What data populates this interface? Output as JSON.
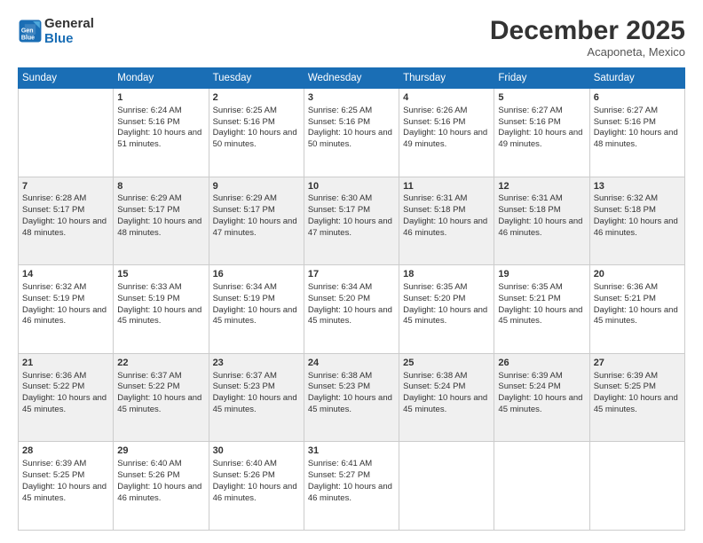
{
  "header": {
    "logo_line1": "General",
    "logo_line2": "Blue",
    "month_title": "December 2025",
    "location": "Acaponeta, Mexico"
  },
  "days_of_week": [
    "Sunday",
    "Monday",
    "Tuesday",
    "Wednesday",
    "Thursday",
    "Friday",
    "Saturday"
  ],
  "weeks": [
    {
      "row_class": "week-odd",
      "days": [
        {
          "num": "",
          "empty": true
        },
        {
          "num": "1",
          "sunrise": "Sunrise: 6:24 AM",
          "sunset": "Sunset: 5:16 PM",
          "daylight": "Daylight: 10 hours and 51 minutes."
        },
        {
          "num": "2",
          "sunrise": "Sunrise: 6:25 AM",
          "sunset": "Sunset: 5:16 PM",
          "daylight": "Daylight: 10 hours and 50 minutes."
        },
        {
          "num": "3",
          "sunrise": "Sunrise: 6:25 AM",
          "sunset": "Sunset: 5:16 PM",
          "daylight": "Daylight: 10 hours and 50 minutes."
        },
        {
          "num": "4",
          "sunrise": "Sunrise: 6:26 AM",
          "sunset": "Sunset: 5:16 PM",
          "daylight": "Daylight: 10 hours and 49 minutes."
        },
        {
          "num": "5",
          "sunrise": "Sunrise: 6:27 AM",
          "sunset": "Sunset: 5:16 PM",
          "daylight": "Daylight: 10 hours and 49 minutes."
        },
        {
          "num": "6",
          "sunrise": "Sunrise: 6:27 AM",
          "sunset": "Sunset: 5:16 PM",
          "daylight": "Daylight: 10 hours and 48 minutes."
        }
      ]
    },
    {
      "row_class": "week-even",
      "days": [
        {
          "num": "7",
          "sunrise": "Sunrise: 6:28 AM",
          "sunset": "Sunset: 5:17 PM",
          "daylight": "Daylight: 10 hours and 48 minutes."
        },
        {
          "num": "8",
          "sunrise": "Sunrise: 6:29 AM",
          "sunset": "Sunset: 5:17 PM",
          "daylight": "Daylight: 10 hours and 48 minutes."
        },
        {
          "num": "9",
          "sunrise": "Sunrise: 6:29 AM",
          "sunset": "Sunset: 5:17 PM",
          "daylight": "Daylight: 10 hours and 47 minutes."
        },
        {
          "num": "10",
          "sunrise": "Sunrise: 6:30 AM",
          "sunset": "Sunset: 5:17 PM",
          "daylight": "Daylight: 10 hours and 47 minutes."
        },
        {
          "num": "11",
          "sunrise": "Sunrise: 6:31 AM",
          "sunset": "Sunset: 5:18 PM",
          "daylight": "Daylight: 10 hours and 46 minutes."
        },
        {
          "num": "12",
          "sunrise": "Sunrise: 6:31 AM",
          "sunset": "Sunset: 5:18 PM",
          "daylight": "Daylight: 10 hours and 46 minutes."
        },
        {
          "num": "13",
          "sunrise": "Sunrise: 6:32 AM",
          "sunset": "Sunset: 5:18 PM",
          "daylight": "Daylight: 10 hours and 46 minutes."
        }
      ]
    },
    {
      "row_class": "week-odd",
      "days": [
        {
          "num": "14",
          "sunrise": "Sunrise: 6:32 AM",
          "sunset": "Sunset: 5:19 PM",
          "daylight": "Daylight: 10 hours and 46 minutes."
        },
        {
          "num": "15",
          "sunrise": "Sunrise: 6:33 AM",
          "sunset": "Sunset: 5:19 PM",
          "daylight": "Daylight: 10 hours and 45 minutes."
        },
        {
          "num": "16",
          "sunrise": "Sunrise: 6:34 AM",
          "sunset": "Sunset: 5:19 PM",
          "daylight": "Daylight: 10 hours and 45 minutes."
        },
        {
          "num": "17",
          "sunrise": "Sunrise: 6:34 AM",
          "sunset": "Sunset: 5:20 PM",
          "daylight": "Daylight: 10 hours and 45 minutes."
        },
        {
          "num": "18",
          "sunrise": "Sunrise: 6:35 AM",
          "sunset": "Sunset: 5:20 PM",
          "daylight": "Daylight: 10 hours and 45 minutes."
        },
        {
          "num": "19",
          "sunrise": "Sunrise: 6:35 AM",
          "sunset": "Sunset: 5:21 PM",
          "daylight": "Daylight: 10 hours and 45 minutes."
        },
        {
          "num": "20",
          "sunrise": "Sunrise: 6:36 AM",
          "sunset": "Sunset: 5:21 PM",
          "daylight": "Daylight: 10 hours and 45 minutes."
        }
      ]
    },
    {
      "row_class": "week-even",
      "days": [
        {
          "num": "21",
          "sunrise": "Sunrise: 6:36 AM",
          "sunset": "Sunset: 5:22 PM",
          "daylight": "Daylight: 10 hours and 45 minutes."
        },
        {
          "num": "22",
          "sunrise": "Sunrise: 6:37 AM",
          "sunset": "Sunset: 5:22 PM",
          "daylight": "Daylight: 10 hours and 45 minutes."
        },
        {
          "num": "23",
          "sunrise": "Sunrise: 6:37 AM",
          "sunset": "Sunset: 5:23 PM",
          "daylight": "Daylight: 10 hours and 45 minutes."
        },
        {
          "num": "24",
          "sunrise": "Sunrise: 6:38 AM",
          "sunset": "Sunset: 5:23 PM",
          "daylight": "Daylight: 10 hours and 45 minutes."
        },
        {
          "num": "25",
          "sunrise": "Sunrise: 6:38 AM",
          "sunset": "Sunset: 5:24 PM",
          "daylight": "Daylight: 10 hours and 45 minutes."
        },
        {
          "num": "26",
          "sunrise": "Sunrise: 6:39 AM",
          "sunset": "Sunset: 5:24 PM",
          "daylight": "Daylight: 10 hours and 45 minutes."
        },
        {
          "num": "27",
          "sunrise": "Sunrise: 6:39 AM",
          "sunset": "Sunset: 5:25 PM",
          "daylight": "Daylight: 10 hours and 45 minutes."
        }
      ]
    },
    {
      "row_class": "week-odd",
      "days": [
        {
          "num": "28",
          "sunrise": "Sunrise: 6:39 AM",
          "sunset": "Sunset: 5:25 PM",
          "daylight": "Daylight: 10 hours and 45 minutes."
        },
        {
          "num": "29",
          "sunrise": "Sunrise: 6:40 AM",
          "sunset": "Sunset: 5:26 PM",
          "daylight": "Daylight: 10 hours and 46 minutes."
        },
        {
          "num": "30",
          "sunrise": "Sunrise: 6:40 AM",
          "sunset": "Sunset: 5:26 PM",
          "daylight": "Daylight: 10 hours and 46 minutes."
        },
        {
          "num": "31",
          "sunrise": "Sunrise: 6:41 AM",
          "sunset": "Sunset: 5:27 PM",
          "daylight": "Daylight: 10 hours and 46 minutes."
        },
        {
          "num": "",
          "empty": true
        },
        {
          "num": "",
          "empty": true
        },
        {
          "num": "",
          "empty": true
        }
      ]
    }
  ]
}
